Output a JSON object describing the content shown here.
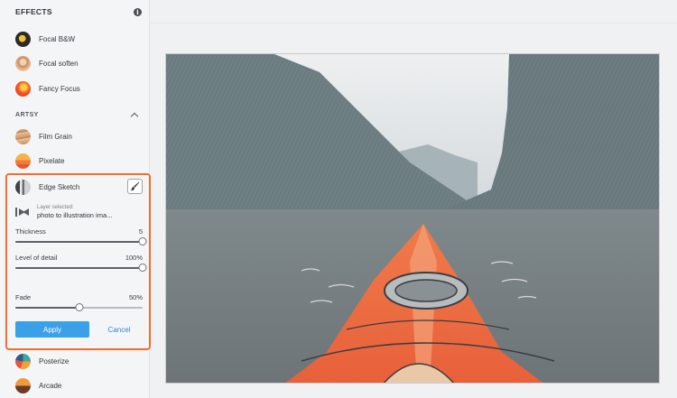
{
  "panel": {
    "title": "EFFECTS",
    "info_icon": "info-icon",
    "items_top": [
      {
        "label": "Focal B&W",
        "icon": "focal-bw-thumb"
      },
      {
        "label": "Focal soften",
        "icon": "focal-soften-thumb"
      },
      {
        "label": "Fancy Focus",
        "icon": "fancy-focus-thumb"
      }
    ],
    "section": {
      "title": "ARTSY",
      "icon": "chevron-up-icon"
    },
    "items_artsy": [
      {
        "label": "Film Grain",
        "icon": "film-grain-thumb"
      },
      {
        "label": "Pixelate",
        "icon": "pixelate-thumb"
      }
    ],
    "items_bottom": [
      {
        "label": "Posterize",
        "icon": "posterize-thumb"
      },
      {
        "label": "Arcade",
        "icon": "arcade-thumb"
      }
    ]
  },
  "editor": {
    "effect_label": "Edge Sketch",
    "brush_icon": "brush-icon",
    "layer_caption": "Layer selected:",
    "layer_name": "photo to illustration ima...",
    "sliders": [
      {
        "label": "Thickness",
        "value_text": "5",
        "fraction": 1.0
      },
      {
        "label": "Level of detail",
        "value_text": "100%",
        "fraction": 1.0
      },
      {
        "label": "Fade",
        "value_text": "50%",
        "fraction": 0.5
      }
    ],
    "apply_label": "Apply",
    "cancel_label": "Cancel"
  },
  "canvas": {
    "subject": "kayak-bow-fjord-edge-sketch"
  }
}
